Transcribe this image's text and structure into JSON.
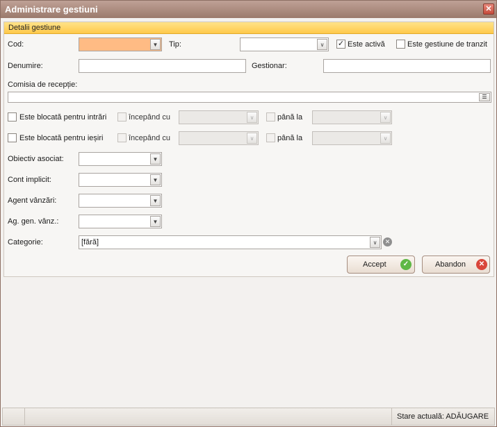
{
  "window": {
    "title": "Administrare gestiuni"
  },
  "panel": {
    "header": "Detalii gestiune"
  },
  "form": {
    "cod_label": "Cod:",
    "tip_label": "Tip:",
    "este_activa_label": "Este activă",
    "este_activa_checked": true,
    "tranzit_label": "Este gestiune de tranzit",
    "denumire_label": "Denumire:",
    "gestionar_label": "Gestionar:",
    "comisia_label": "Comisia de recepție:",
    "blocata_intrari_label": "Este blocată pentru intrări",
    "blocata_iesiri_label": "Este blocată pentru ieșiri",
    "incepand_label": "începând cu",
    "pana_la_label": "până la",
    "obiectiv_label": "Obiectiv asociat:",
    "cont_label": "Cont implicit:",
    "agent_label": "Agent vânzări:",
    "ag_gen_label": "Ag. gen. vânz.:",
    "categorie_label": "Categorie:",
    "categorie_value": "[fără]"
  },
  "buttons": {
    "accept": "Accept",
    "abandon": "Abandon"
  },
  "status": {
    "stare": "Stare actuală: ADĂUGARE"
  },
  "icons": {
    "close": "close-icon",
    "dropdown": "chevron-down-icon",
    "ellipsis": "list-icon",
    "clear": "clear-icon",
    "accept": "check-circle-icon",
    "abandon": "cancel-circle-icon"
  },
  "colors": {
    "title_bar": "#a98a7d",
    "panel_header": "#ffd463",
    "required_field": "#ffbb84",
    "accept_icon": "#5fb846",
    "abandon_icon": "#d9453a"
  }
}
